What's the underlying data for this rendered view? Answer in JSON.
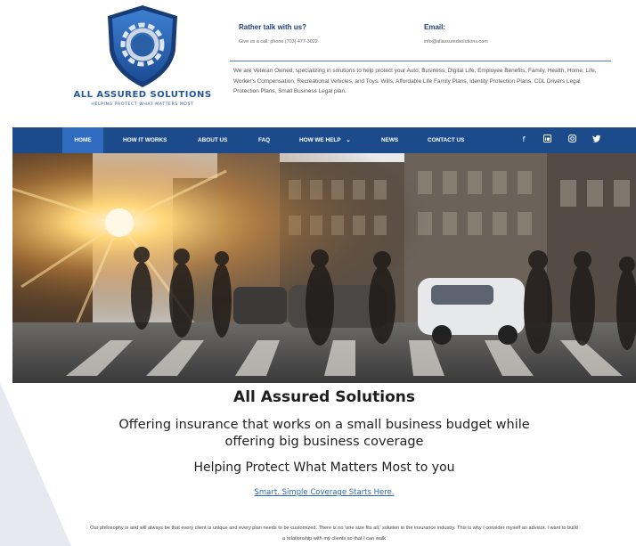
{
  "header": {
    "logo_name": "ALL ASSURED SOLUTIONS",
    "logo_tagline": "HELPING PROTECT WHAT MATTERS MOST",
    "talk_label": "Rather talk with us?",
    "talk_value": "Give us a call: phone (703) 477-3022",
    "email_label": "Email:",
    "email_value": "info@allassuredsolutions.com",
    "blurb": "We are Veteran Owned, specializing in solutions to help protect your Auto, Business, Digital Life, Employee Benefits, Family, Health, Home, Life, Worker's Compensation, Recreational Vehicles, and Toys. Wills, Affordable Life Family Plans, Identity Protection Plans, CDL Drivers Legal Protection Plans, Small Business Legal plan."
  },
  "nav": {
    "items": [
      "HOME",
      "HOW IT WORKS",
      "ABOUT US",
      "FAQ",
      "HOW WE HELP",
      "NEWS",
      "CONTACT US"
    ],
    "dropdown_caret": "⌄",
    "social": [
      "f",
      "in",
      "ig",
      "tw"
    ]
  },
  "colors": {
    "brand_blue": "#1c4b8c",
    "active_tab": "#2f6bbf",
    "link": "#2c6ab5"
  },
  "content": {
    "title": "All Assured Solutions",
    "subtitle": "Offering insurance that works on a small business budget while offering big business coverage",
    "tagline": "Helping Protect What Matters Most to you",
    "cta": "Smart. Simple Coverage Starts Here.",
    "paragraph": "Our philosophy is and will always be that every client is unique and every plan needs to be customized. There is no 'one size fits all,' solution in the insurance industry. This is why I consider myself an advisor. I want to build a relationship with my clients so that I can walk"
  }
}
